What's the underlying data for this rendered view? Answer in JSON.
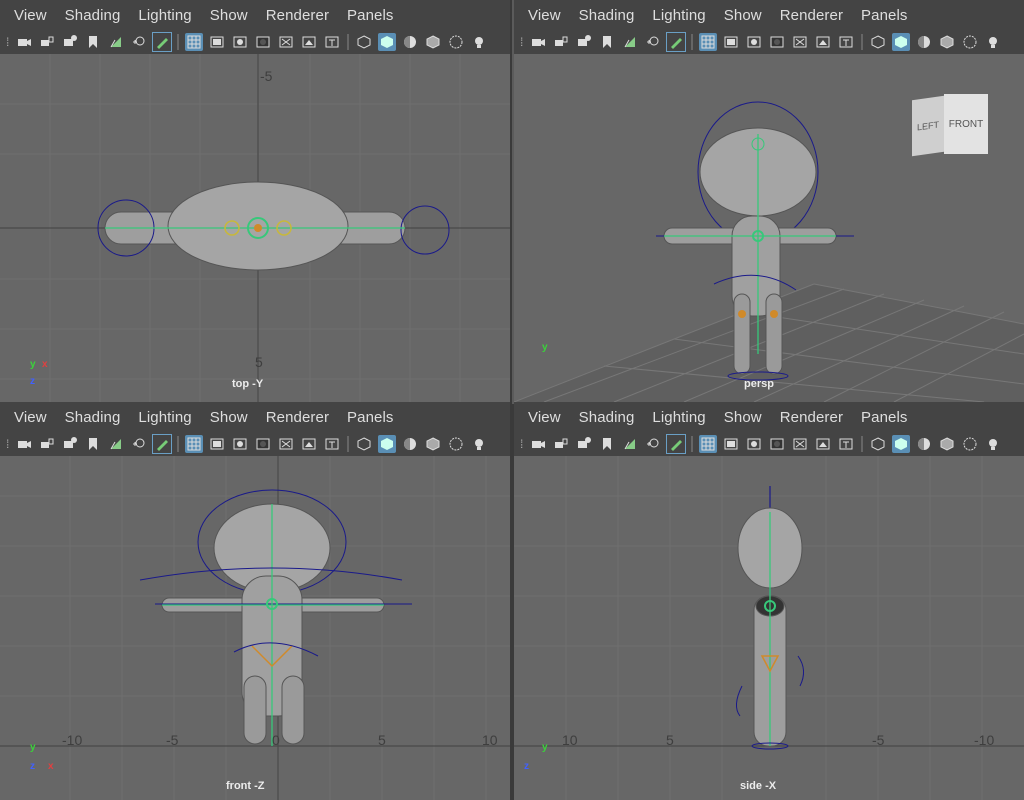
{
  "menu": [
    "View",
    "Shading",
    "Lighting",
    "Show",
    "Renderer",
    "Panels"
  ],
  "toolbar_icons": [
    "camera-select-icon",
    "camera-lock-icon",
    "camera-attributes-icon",
    "bookmark-icon",
    "image-plane-icon",
    "2d-pan-zoom-icon",
    "grease-pencil-icon",
    "grid-icon",
    "film-gate-icon",
    "resolution-gate-icon",
    "gate-mask-icon",
    "field-chart-icon",
    "safe-action-icon",
    "safe-title-icon",
    "wireframe-icon",
    "smooth-shade-icon",
    "default-material-icon",
    "textured-icon",
    "xray-icon",
    "lighting-icon"
  ],
  "panes": {
    "top": {
      "camera": "top -Y",
      "ticks": [
        "-5",
        "5"
      ],
      "axis_y": "y",
      "axis_x": "x",
      "axis_z": "z"
    },
    "persp": {
      "camera": "persp",
      "axis_y": "y",
      "viewcube_left": "LEFT",
      "viewcube_front": "FRONT"
    },
    "front": {
      "camera": "front -Z",
      "ticks": [
        "-10",
        "-5",
        "0",
        "5",
        "10"
      ],
      "axis_y": "y",
      "axis_x": "x",
      "axis_z": "z"
    },
    "side": {
      "camera": "side -X",
      "ticks": [
        "10",
        "5",
        "-5",
        "-10"
      ],
      "axis_y": "y",
      "axis_z": "z"
    }
  },
  "colors": {
    "viewport_bg": "#676767",
    "panel_bg": "#444444",
    "mesh": "#9a9a9a",
    "joint_green": "#37c87a",
    "control_blue": "#1a1a8a",
    "joint_orange": "#d08a2a",
    "selected_blue": "#5a8fb5"
  }
}
